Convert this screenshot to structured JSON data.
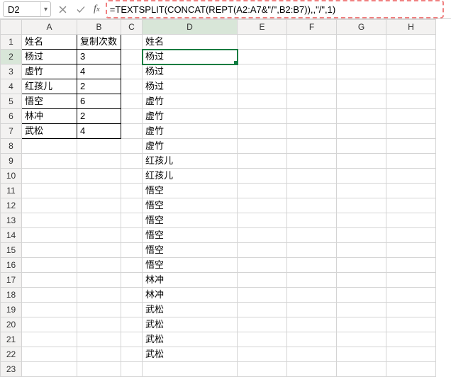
{
  "namebox": {
    "value": "D2"
  },
  "formula": {
    "value": "=TEXTSPLIT(CONCAT(REPT(A2:A7&\"/\",B2:B7)),,\"/\",1)"
  },
  "colHeaders": [
    "A",
    "B",
    "C",
    "D",
    "E",
    "F",
    "G",
    "H"
  ],
  "rowCount": 23,
  "left": {
    "header": {
      "name": "姓名",
      "count": "复制次数"
    },
    "rows": [
      {
        "name": "杨过",
        "count": "3"
      },
      {
        "name": "虚竹",
        "count": "4"
      },
      {
        "name": "红孩儿",
        "count": "2"
      },
      {
        "name": "悟空",
        "count": "6"
      },
      {
        "name": "林冲",
        "count": "2"
      },
      {
        "name": "武松",
        "count": "4"
      }
    ]
  },
  "right": {
    "header": "姓名",
    "values": [
      "杨过",
      "杨过",
      "杨过",
      "虚竹",
      "虚竹",
      "虚竹",
      "虚竹",
      "红孩儿",
      "红孩儿",
      "悟空",
      "悟空",
      "悟空",
      "悟空",
      "悟空",
      "悟空",
      "林冲",
      "林冲",
      "武松",
      "武松",
      "武松",
      "武松"
    ]
  },
  "chart_data": {
    "type": "table",
    "title": "Name repetition via TEXTSPLIT/REPT",
    "input": {
      "columns": [
        "姓名",
        "复制次数"
      ],
      "rows": [
        [
          "杨过",
          3
        ],
        [
          "虚竹",
          4
        ],
        [
          "红孩儿",
          2
        ],
        [
          "悟空",
          6
        ],
        [
          "林冲",
          2
        ],
        [
          "武松",
          4
        ]
      ]
    },
    "output_column": "姓名",
    "output_values": [
      "杨过",
      "杨过",
      "杨过",
      "虚竹",
      "虚竹",
      "虚竹",
      "虚竹",
      "红孩儿",
      "红孩儿",
      "悟空",
      "悟空",
      "悟空",
      "悟空",
      "悟空",
      "悟空",
      "林冲",
      "林冲",
      "武松",
      "武松",
      "武松",
      "武松"
    ]
  }
}
